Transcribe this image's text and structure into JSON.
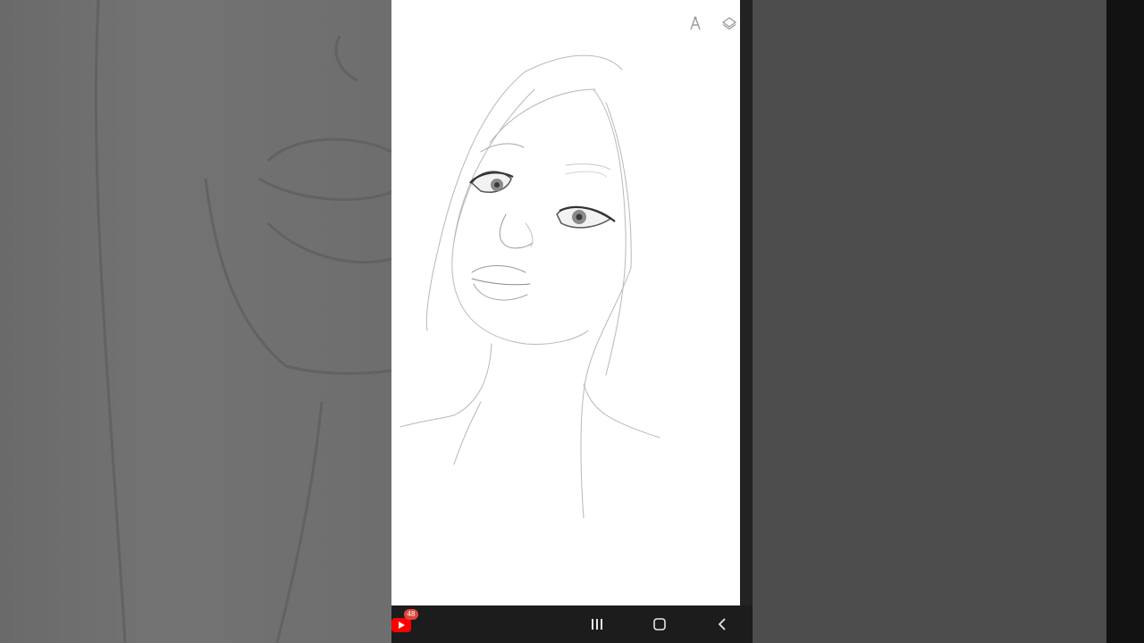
{
  "app": {
    "name": "drawing-app"
  },
  "toolbar": {
    "ruler_icon": "compass-ruler-icon",
    "layers_icon": "layers-icon"
  },
  "navbar": {
    "recents_icon": "recents-icon",
    "home_icon": "home-icon",
    "back_icon": "back-icon",
    "notification": {
      "app_icon": "youtube-icon",
      "badge_count": "48"
    }
  },
  "colors": {
    "canvas": "#ffffff",
    "navbar": "#1c1c1c",
    "badge": "#e1453a",
    "youtube_red": "#ff0000"
  }
}
